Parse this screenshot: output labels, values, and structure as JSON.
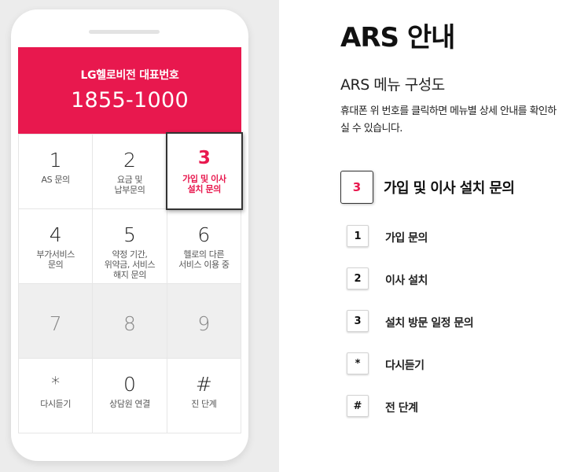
{
  "phone": {
    "header_title": "LG헬로비전 대표번호",
    "header_number": "1855-1000",
    "keys": [
      {
        "num": "1",
        "label": "AS 문의"
      },
      {
        "num": "2",
        "label": "요금 및\n납부문의"
      },
      {
        "num": "3",
        "label": "가입 및 이사\n설치 문의"
      },
      {
        "num": "4",
        "label": "부가서비스\n문의"
      },
      {
        "num": "5",
        "label": "약정 기간,\n위약금, 서비스\n해지 문의"
      },
      {
        "num": "6",
        "label": "헬로의 다른\n서비스 이용 중"
      },
      {
        "num": "7",
        "label": ""
      },
      {
        "num": "8",
        "label": ""
      },
      {
        "num": "9",
        "label": ""
      },
      {
        "num": "*",
        "label": "다시듣기"
      },
      {
        "num": "0",
        "label": "상담원 연결"
      },
      {
        "num": "#",
        "label": "진 단계"
      }
    ]
  },
  "guide": {
    "title": "ARS 안내",
    "subtitle": "ARS 메뉴 구성도",
    "description": "휴대폰 위 번호를 클릭하면 메뉴별 상세 안내를 확인하실 수 있습니다.",
    "selected": {
      "num": "3",
      "label": "가입 및 이사 설치 문의"
    },
    "items": [
      {
        "num": "1",
        "label": "가입 문의"
      },
      {
        "num": "2",
        "label": "이사 설치"
      },
      {
        "num": "3",
        "label": "설치 방문 일정 문의"
      },
      {
        "num": "*",
        "label": "다시듣기"
      },
      {
        "num": "#",
        "label": "전 단계"
      }
    ]
  },
  "colors": {
    "accent": "#e8184e",
    "background_left": "#ececec",
    "disabled_key": "#efefef"
  }
}
